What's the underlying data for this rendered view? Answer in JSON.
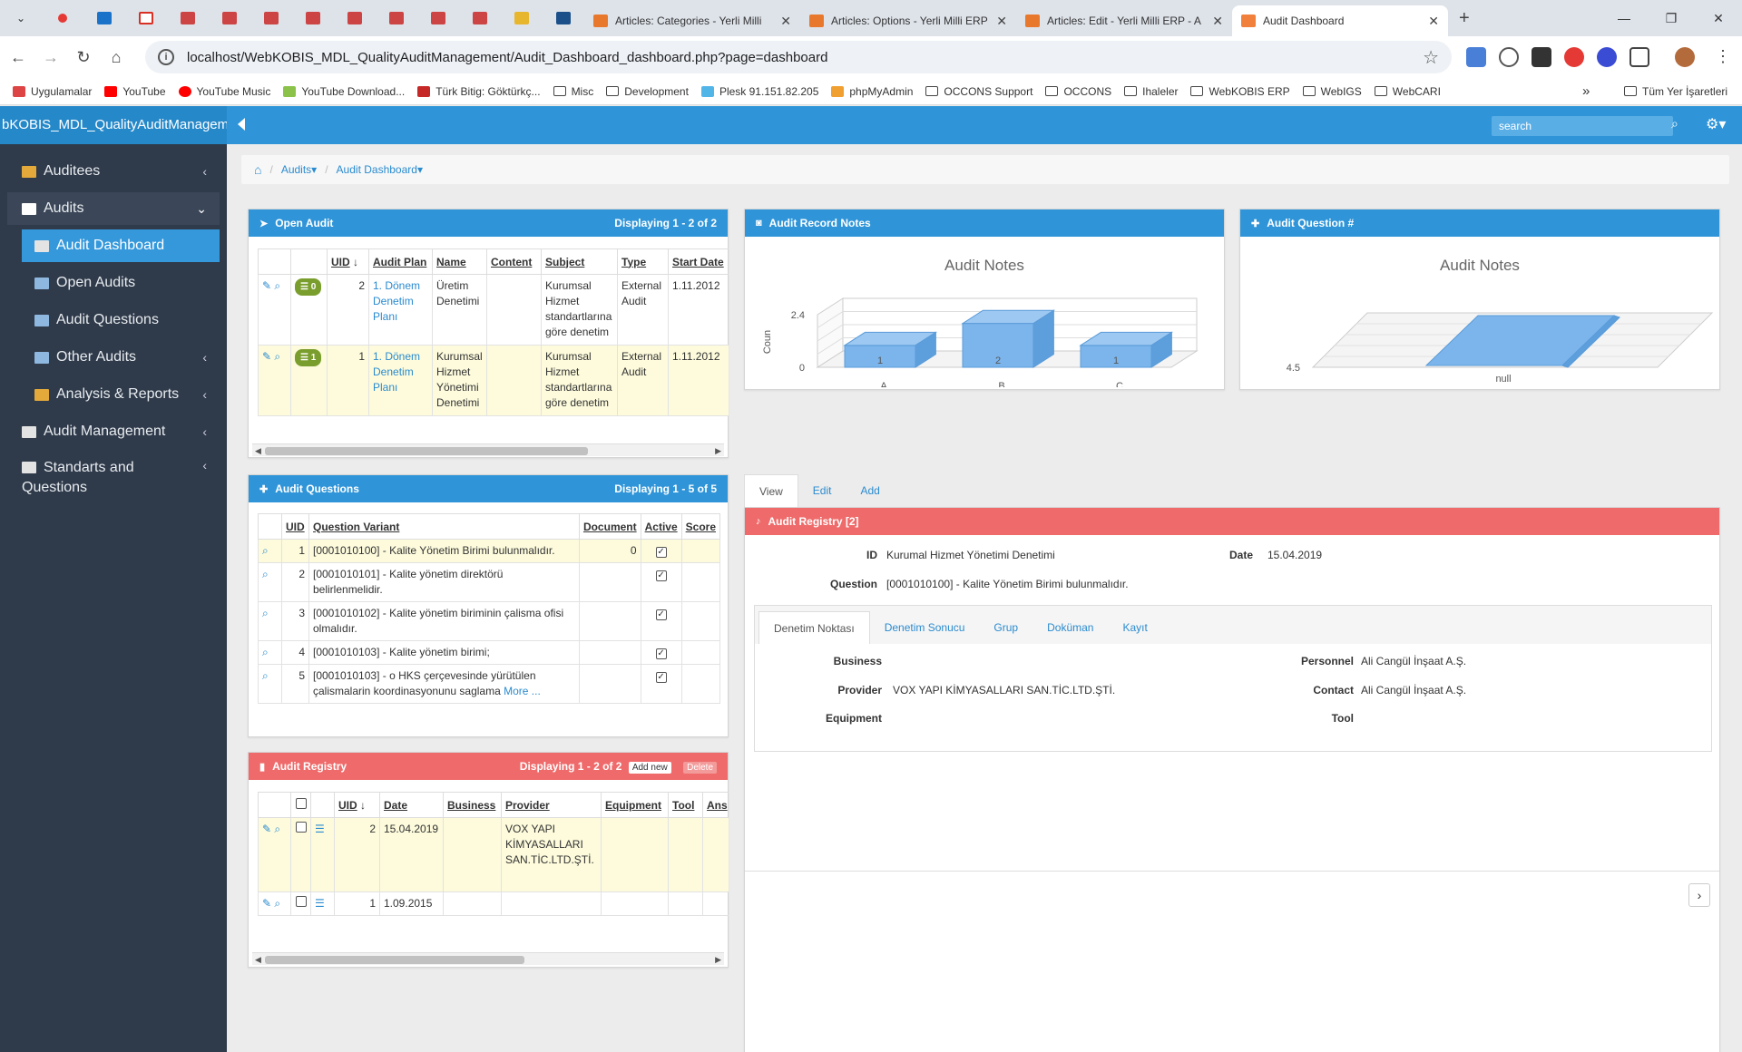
{
  "browser": {
    "tabs": [
      {
        "label": "Articles: Categories - Yerli Milli",
        "color": "#e8792c"
      },
      {
        "label": "Articles: Options - Yerli Milli ERP",
        "color": "#e8792c"
      },
      {
        "label": "Articles: Edit - Yerli Milli ERP - A",
        "color": "#e8792c"
      },
      {
        "label": "Audit Dashboard",
        "color": "#f0803c",
        "active": true
      }
    ],
    "url": "localhost/WebKOBIS_MDL_QualityAuditManagement/Audit_Dashboard_dashboard.php?page=dashboard",
    "bookmarks": [
      {
        "label": "Uygulamalar",
        "icon": "apps-icon"
      },
      {
        "label": "YouTube",
        "icon": "youtube-icon"
      },
      {
        "label": "YouTube Music",
        "icon": "youtube-music-icon"
      },
      {
        "label": "YouTube Download...",
        "icon": "download-icon"
      },
      {
        "label": "Türk Bitig: Göktürkç...",
        "icon": "turk-bitig-icon"
      },
      {
        "label": "Misc",
        "icon": "folder-icon"
      },
      {
        "label": "Development",
        "icon": "folder-icon"
      },
      {
        "label": "Plesk 91.151.82.205",
        "icon": "plesk-icon"
      },
      {
        "label": "phpMyAdmin",
        "icon": "phpmyadmin-icon"
      },
      {
        "label": "OCCONS Support",
        "icon": "folder-icon"
      },
      {
        "label": "OCCONS",
        "icon": "folder-icon"
      },
      {
        "label": "Ihaleler",
        "icon": "folder-icon"
      },
      {
        "label": "WebKOBIS ERP",
        "icon": "folder-icon"
      },
      {
        "label": "WebIGS",
        "icon": "folder-icon"
      },
      {
        "label": "WebCARI",
        "icon": "folder-icon"
      }
    ],
    "more": "»",
    "all_bookmarks": "Tüm Yer İşaretleri"
  },
  "app": {
    "title": "bKOBIS_MDL_QualityAuditManagem",
    "search_placeholder": "search"
  },
  "sidebar": [
    {
      "label": "Auditees",
      "chev": "‹",
      "color": "#e3a93a"
    },
    {
      "label": "Audits",
      "chev": "⌄",
      "color": "#ffffff"
    },
    {
      "label": "Audit Dashboard",
      "color": "#e3e3e3"
    },
    {
      "label": "Open Audits",
      "color": "#8fb8e0"
    },
    {
      "label": "Audit Questions",
      "color": "#8fb8e0"
    },
    {
      "label": "Other Audits",
      "chev": "‹",
      "color": "#8fb8e0"
    },
    {
      "label": "Analysis & Reports",
      "chev": "‹",
      "color": "#e3a93a"
    },
    {
      "label": "Audit Management",
      "chev": "‹",
      "color": "#e3e3e3"
    },
    {
      "label": "Standarts and Questions",
      "chev": "‹",
      "color": "#e3e3e3"
    }
  ],
  "breadcrumb": {
    "audits": "Audits",
    "dashboard": "Audit Dashboard"
  },
  "open_audit": {
    "title": "Open Audit",
    "displaying": "Displaying 1 - 2 of 2",
    "headers": [
      "UID",
      "Audit Plan",
      "Name",
      "Content",
      "Subject",
      "Type",
      "Start Date"
    ],
    "rows": [
      {
        "badge": "0",
        "uid": "2",
        "plan": "1. Dönem Denetim Planı",
        "name": "Üretim Denetimi",
        "content": "",
        "subject": "Kurumsal Hizmet standartlarına göre denetim",
        "type": "External Audit",
        "start": "1.11.2012"
      },
      {
        "badge": "1",
        "uid": "1",
        "plan": "1. Dönem Denetim Planı",
        "name": "Kurumsal Hizmet Yönetimi Denetimi",
        "content": "",
        "subject": "Kurumsal Hizmet standartlarına göre denetim",
        "type": "External Audit",
        "start": "1.11.2012"
      }
    ]
  },
  "notes_chart": {
    "panel_title": "Audit Record Notes",
    "chart_data": {
      "type": "bar",
      "title": "Audit Notes",
      "ylabel": "Coun",
      "categories": [
        "A",
        "B",
        "C"
      ],
      "values": [
        1,
        2,
        1
      ],
      "ylim": [
        0,
        2.4
      ],
      "yticks": [
        "0",
        "2.4"
      ],
      "data_labels": [
        "1",
        "2",
        "1"
      ]
    }
  },
  "question_chart": {
    "panel_title": "Audit Question #",
    "chart_data": {
      "type": "bar",
      "title": "Audit Notes",
      "categories": [
        "null"
      ],
      "values": [
        4.5
      ],
      "yticks": [
        "4.5"
      ]
    }
  },
  "audit_questions": {
    "title": "Audit Questions",
    "displaying": "Displaying 1 - 5 of 5",
    "headers": [
      "UID",
      "Question Variant",
      "Document",
      "Active",
      "Score"
    ],
    "rows": [
      {
        "uid": "1",
        "text": "[0001010100] - Kalite Yönetim Birimi bulunmalıdır.",
        "doc": "0"
      },
      {
        "uid": "2",
        "text": "[0001010101] - Kalite yönetim direktörü belirlenmelidir.",
        "doc": ""
      },
      {
        "uid": "3",
        "text": "[0001010102] - Kalite yönetim biriminin çalisma ofisi olmalıdır.",
        "doc": ""
      },
      {
        "uid": "4",
        "text": "[0001010103] - Kalite yönetim birimi;",
        "doc": ""
      },
      {
        "uid": "5",
        "text": "[0001010103] - o HKS çerçevesinde yürütülen çalismalarin koordinasyonunu saglama",
        "doc": "",
        "more": "More ..."
      }
    ]
  },
  "audit_registry": {
    "title": "Audit Registry",
    "displaying": "Displaying 1 - 2 of 2",
    "add": "Add new",
    "delete": "Delete",
    "headers": [
      "UID",
      "Date",
      "Business",
      "Provider",
      "Equipment",
      "Tool",
      "Ans"
    ],
    "rows": [
      {
        "uid": "2",
        "date": "15.04.2019",
        "provider": "VOX YAPI KİMYASALLARI SAN.TİC.LTD.ŞTİ."
      },
      {
        "uid": "1",
        "date": "1.09.2015",
        "provider": ""
      }
    ]
  },
  "detail": {
    "tabs": [
      "View",
      "Edit",
      "Add"
    ],
    "title": "Audit Registry [2]",
    "id_label": "ID",
    "id_value": "Kurumal Hizmet Yönetimi Denetimi",
    "date_label": "Date",
    "date_value": "15.04.2019",
    "question_label": "Question",
    "question_value": "[0001010100] - Kalite Yönetim Birimi bulunmalıdır.",
    "subtabs": [
      "Denetim Noktası",
      "Denetim Sonucu",
      "Grup",
      "Doküman",
      "Kayıt"
    ],
    "business_label": "Business",
    "provider_label": "Provider",
    "provider_value": "VOX YAPI KİMYASALLARI SAN.TİC.LTD.ŞTİ.",
    "equipment_label": "Equipment",
    "personnel_label": "Personnel",
    "personnel_value": "Ali Cangül İnşaat A.Ş.",
    "contact_label": "Contact",
    "contact_value": "Ali Cangül İnşaat A.Ş.",
    "tool_label": "Tool"
  }
}
